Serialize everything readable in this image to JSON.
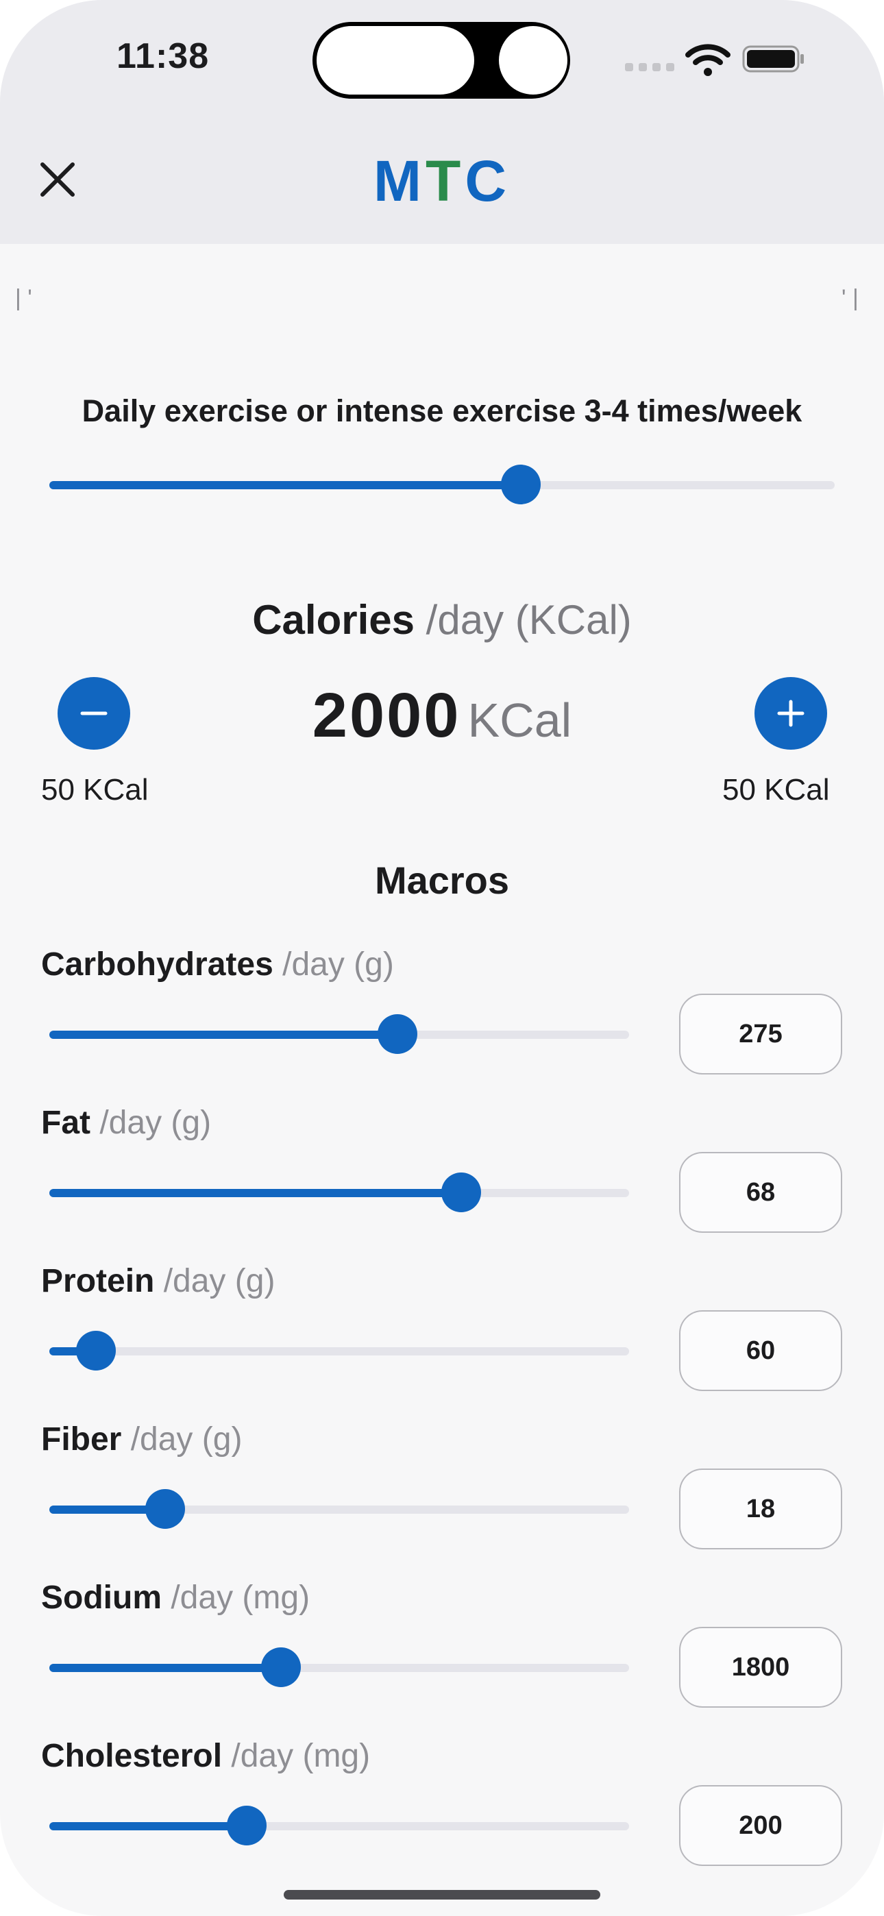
{
  "status_bar": {
    "time": "11:38"
  },
  "header": {
    "title_letters": [
      "M",
      "T",
      "C"
    ],
    "colors": {
      "primary": "#1166c0",
      "accent_green": "#2a8b4b"
    }
  },
  "activity": {
    "label": "Daily exercise or intense exercise 3-4 times/week",
    "level_fraction": 0.6
  },
  "calories": {
    "title": "Calories",
    "title_unit": "/day (KCal)",
    "value": "2000",
    "value_unit": "KCal",
    "decrement_label": "50 KCal",
    "increment_label": "50 KCal"
  },
  "macros": {
    "title": "Macros",
    "items": [
      {
        "name": "Carbohydrates",
        "unit": "/day (g)",
        "value": "275",
        "fraction": 0.6
      },
      {
        "name": "Fat",
        "unit": "/day (g)",
        "value": "68",
        "fraction": 0.71
      },
      {
        "name": "Protein",
        "unit": "/day (g)",
        "value": "60",
        "fraction": 0.08
      },
      {
        "name": "Fiber",
        "unit": "/day (g)",
        "value": "18",
        "fraction": 0.2
      },
      {
        "name": "Sodium",
        "unit": "/day (mg)",
        "value": "1800",
        "fraction": 0.4
      },
      {
        "name": "Cholesterol",
        "unit": "/day (mg)",
        "value": "200",
        "fraction": 0.34
      }
    ]
  }
}
